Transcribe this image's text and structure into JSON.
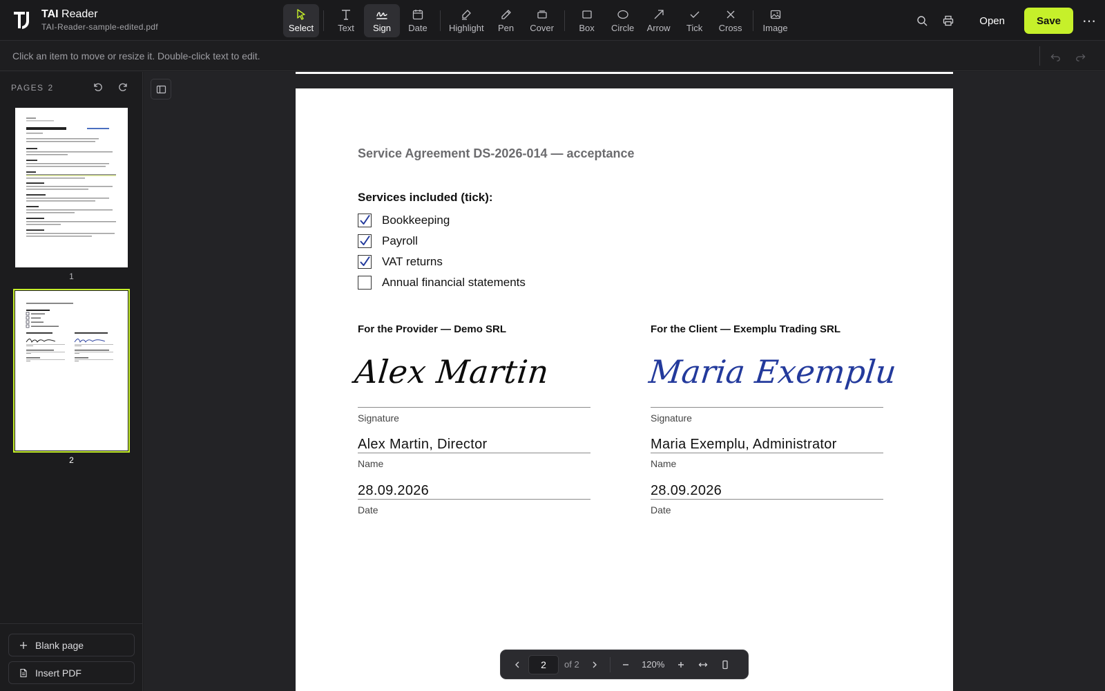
{
  "app": {
    "brand_bold": "TAI",
    "brand_rest": "Reader",
    "file_name": "TAI-Reader-sample-edited.pdf"
  },
  "toolbar": {
    "tools": [
      {
        "label": "Select",
        "icon": "cursor-icon"
      },
      {
        "label": "Text",
        "icon": "text-icon"
      },
      {
        "label": "Sign",
        "icon": "signature-icon"
      },
      {
        "label": "Date",
        "icon": "calendar-icon"
      },
      {
        "label": "Highlight",
        "icon": "highlighter-icon"
      },
      {
        "label": "Pen",
        "icon": "pen-icon"
      },
      {
        "label": "Cover",
        "icon": "eraser-icon"
      },
      {
        "label": "Box",
        "icon": "square-icon"
      },
      {
        "label": "Circle",
        "icon": "circle-icon"
      },
      {
        "label": "Arrow",
        "icon": "arrow-icon"
      },
      {
        "label": "Tick",
        "icon": "check-icon"
      },
      {
        "label": "Cross",
        "icon": "cross-icon"
      },
      {
        "label": "Image",
        "icon": "image-icon"
      }
    ],
    "open_label": "Open",
    "save_label": "Save",
    "more_label": "⋯",
    "accent_color": "#c6f02a"
  },
  "hint": "Click an item to move or resize it. Double-click text to edit.",
  "sidebar": {
    "pages_label": "PAGES",
    "pages_count": "2",
    "thumb_numbers": [
      "1",
      "2"
    ],
    "blank_page_label": "Blank page",
    "insert_pdf_label": "Insert PDF"
  },
  "document": {
    "title": "Service Agreement DS-2026-014 — acceptance",
    "services_heading": "Services included (tick):",
    "services": [
      {
        "label": "Bookkeeping",
        "checked": true
      },
      {
        "label": "Payroll",
        "checked": true
      },
      {
        "label": "VAT returns",
        "checked": true
      },
      {
        "label": "Annual financial statements",
        "checked": false
      }
    ],
    "provider": {
      "heading": "For the Provider — Demo SRL",
      "signature": "Alex Martin",
      "signature_label": "Signature",
      "name": "Alex Martin, Director",
      "name_label": "Name",
      "date": "28.09.2026",
      "date_label": "Date"
    },
    "client": {
      "heading": "For the Client — Exemplu Trading SRL",
      "signature": "Maria Exemplu",
      "signature_label": "Signature",
      "name": "Maria Exemplu, Administrator",
      "name_label": "Name",
      "date": "28.09.2026",
      "date_label": "Date"
    }
  },
  "pager": {
    "current_page": "2",
    "of_label": "of 2",
    "zoom": "120%"
  }
}
